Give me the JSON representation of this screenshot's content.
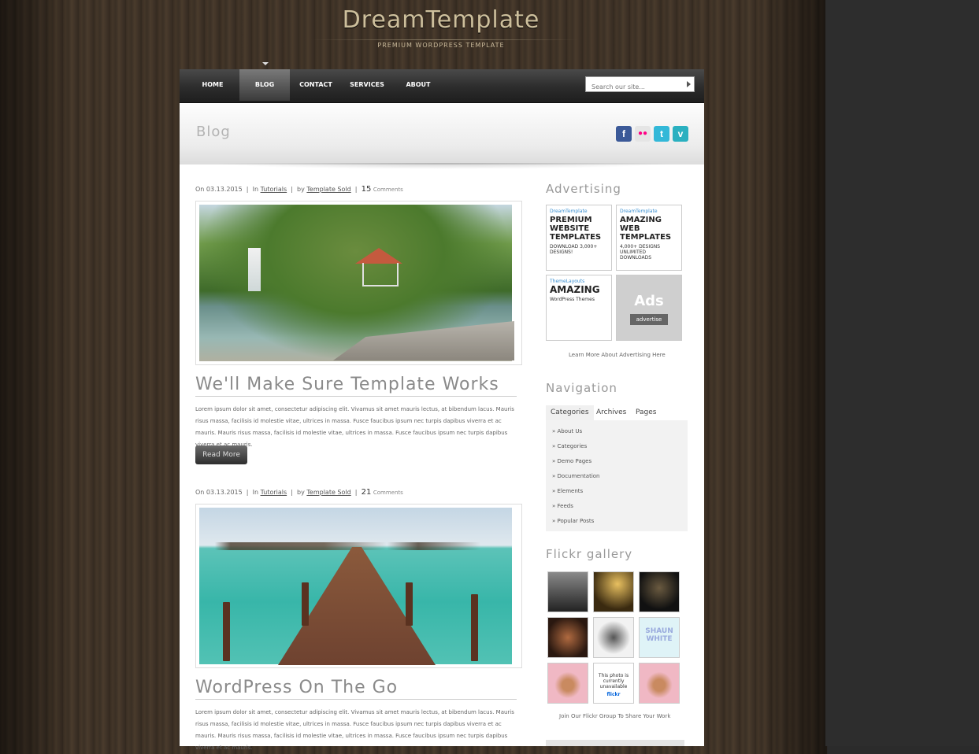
{
  "site": {
    "title": "DreamTemplate",
    "subtitle": "PREMIUM WORDPRESS TEMPLATE"
  },
  "nav": {
    "items": [
      {
        "label": "HOME",
        "active": false
      },
      {
        "label": "BLOG",
        "active": true
      },
      {
        "label": "CONTACT",
        "active": false
      },
      {
        "label": "SERVICES",
        "active": false
      },
      {
        "label": "ABOUT",
        "active": false
      }
    ],
    "search_placeholder": "Search our site..."
  },
  "page": {
    "title": "Blog",
    "social": [
      {
        "icon": "facebook-icon",
        "glyph": "f"
      },
      {
        "icon": "flickr-icon",
        "glyph": "●●"
      },
      {
        "icon": "twitter-icon",
        "glyph": "t"
      },
      {
        "icon": "vimeo-icon",
        "glyph": "v"
      }
    ]
  },
  "posts": [
    {
      "date_prefix": "On 03.13.2015",
      "in_label": "In",
      "category": "Tutorials",
      "by_label": "by",
      "author": "Template Sold",
      "comments": "15",
      "comments_label": "Comments",
      "title": "We'll Make Sure Template Works",
      "body": "Lorem ipsum dolor sit amet, consectetur adipiscing elit. Vivamus sit amet mauris lectus, at bibendum lacus. Mauris risus massa, facilisis id molestie vitae, ultrices in massa. Fusce faucibus ipsum nec turpis dapibus viverra et ac mauris. Mauris risus massa, facilisis id molestie vitae, ultrices in massa. Fusce faucibus ipsum nec turpis dapibus viverra et ac mauris.",
      "read_more": "Read More"
    },
    {
      "date_prefix": "On 03.13.2015",
      "in_label": "In",
      "category": "Tutorials",
      "by_label": "by",
      "author": "Template Sold",
      "comments": "21",
      "comments_label": "Comments",
      "title": "WordPress On The Go",
      "body": "Lorem ipsum dolor sit amet, consectetur adipiscing elit. Vivamus sit amet mauris lectus, at bibendum lacus. Mauris risus massa, facilisis id molestie vitae, ultrices in massa. Fusce faucibus ipsum nec turpis dapibus viverra et ac mauris. Mauris risus massa, facilisis id molestie vitae, ultrices in massa. Fusce faucibus ipsum nec turpis dapibus viverra et ac mauris."
    }
  ],
  "sidebar": {
    "advertising": {
      "heading": "Advertising",
      "ads": [
        {
          "brand": "DreamTemplate",
          "headline": "PREMIUM WEBSITE TEMPLATES",
          "detail": "DOWNLOAD 3,000+ DESIGNS!"
        },
        {
          "brand": "DreamTemplate",
          "headline": "AMAZING WEB TEMPLATES",
          "detail": "4,000+ DESIGNS UNLIMITED DOWNLOADS"
        },
        {
          "brand": "ThemeLayouts",
          "headline": "AMAZING",
          "detail": "WordPress Themes"
        },
        {
          "brand": "",
          "headline": "Ads",
          "detail": "advertise"
        }
      ],
      "link": "Learn More About Advertising Here"
    },
    "navigation": {
      "heading": "Navigation",
      "tabs": [
        {
          "label": "Categories",
          "active": true
        },
        {
          "label": "Archives",
          "active": false
        },
        {
          "label": "Pages",
          "active": false
        }
      ],
      "links": [
        "About Us",
        "Categories",
        "Demo Pages",
        "Documentation",
        "Elements",
        "Feeds",
        "Popular Posts"
      ]
    },
    "flickr": {
      "heading": "Flickr gallery",
      "thumbs": [
        {
          "bg": "#3a3a3a"
        },
        {
          "bg": "#4a3a14"
        },
        {
          "bg": "#2a241c"
        },
        {
          "bg": "#6b3a2a"
        },
        {
          "bg": "#e6e6e6"
        },
        {
          "bg": "#dff3f7",
          "text": "SHAUN WHITE"
        },
        {
          "bg": "#f0c0c8"
        },
        {
          "bg": "#ffffff",
          "text": "This photo is currently unavailable",
          "sub": "flickr"
        },
        {
          "bg": "#f0c0c8"
        }
      ],
      "link": "Join Our Flickr Group To Share Your Work"
    }
  }
}
